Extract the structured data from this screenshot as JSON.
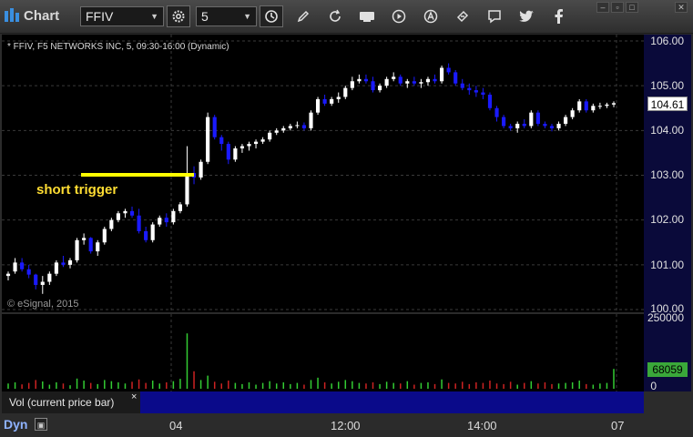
{
  "toolbar": {
    "title": "Chart",
    "symbol": "FFIV",
    "interval": "5",
    "icons": [
      "gear-icon",
      "clock-icon",
      "pencil-icon",
      "refresh-icon",
      "get-icon",
      "play-icon",
      "alert-icon",
      "link-icon",
      "chat-icon",
      "twitter-icon",
      "facebook-icon"
    ]
  },
  "header": {
    "info": "* FFIV, F5 NETWORKS INC, 5, 09:30-16:00 (Dynamic)",
    "watermark": "© eSignal, 2015"
  },
  "annotation": {
    "label": "short trigger",
    "price": 102.97,
    "color": "#ffff00"
  },
  "price_axis": {
    "labels": [
      "106.00",
      "105.00",
      "104.00",
      "103.00",
      "102.00",
      "101.00",
      "100.00"
    ],
    "last_price": "104.61"
  },
  "volume_axis": {
    "top": "250000",
    "zero": "0",
    "last_volume": "68059"
  },
  "time_axis": {
    "labels": [
      "04",
      "12:00",
      "14:00",
      "07"
    ]
  },
  "study": {
    "label": "Vol (current price bar)",
    "close": "×"
  },
  "footer": {
    "mode": "Dyn"
  },
  "colors": {
    "up_candle": "#ffffff",
    "down_candle": "#1a1aff",
    "volume_up": "#33cc33",
    "volume_down": "#cc2222",
    "background": "#000000"
  },
  "chart_data": {
    "type": "candlestick",
    "ylim": [
      100,
      106
    ],
    "ohlc": [
      [
        100.75,
        100.85,
        100.65,
        100.8
      ],
      [
        100.85,
        101.15,
        100.8,
        101.05
      ],
      [
        101.05,
        101.15,
        100.85,
        100.9
      ],
      [
        100.9,
        101.0,
        100.7,
        100.78
      ],
      [
        100.78,
        100.8,
        100.45,
        100.55
      ],
      [
        100.55,
        100.75,
        100.35,
        100.62
      ],
      [
        100.62,
        100.85,
        100.55,
        100.8
      ],
      [
        100.8,
        101.1,
        100.75,
        101.05
      ],
      [
        101.05,
        101.2,
        100.95,
        101.0
      ],
      [
        101.0,
        101.15,
        100.92,
        101.1
      ],
      [
        101.1,
        101.6,
        101.05,
        101.55
      ],
      [
        101.55,
        101.7,
        101.45,
        101.6
      ],
      [
        101.6,
        101.62,
        101.25,
        101.3
      ],
      [
        101.3,
        101.55,
        101.2,
        101.5
      ],
      [
        101.5,
        101.85,
        101.45,
        101.8
      ],
      [
        101.8,
        102.05,
        101.75,
        102.0
      ],
      [
        102.0,
        102.2,
        101.95,
        102.15
      ],
      [
        102.15,
        102.25,
        102.05,
        102.2
      ],
      [
        102.2,
        102.3,
        102.05,
        102.1
      ],
      [
        102.1,
        102.25,
        101.7,
        101.75
      ],
      [
        101.75,
        101.85,
        101.5,
        101.55
      ],
      [
        101.55,
        101.95,
        101.5,
        101.9
      ],
      [
        101.9,
        102.1,
        101.85,
        102.05
      ],
      [
        102.05,
        102.15,
        101.85,
        101.95
      ],
      [
        101.95,
        102.25,
        101.9,
        102.2
      ],
      [
        102.2,
        102.4,
        102.15,
        102.35
      ],
      [
        102.35,
        103.65,
        102.3,
        103.05
      ],
      [
        103.05,
        103.2,
        102.8,
        102.95
      ],
      [
        102.95,
        103.35,
        102.9,
        103.3
      ],
      [
        103.3,
        104.4,
        103.25,
        104.3
      ],
      [
        104.3,
        104.35,
        103.8,
        103.85
      ],
      [
        103.85,
        103.9,
        103.55,
        103.7
      ],
      [
        103.7,
        103.75,
        103.25,
        103.35
      ],
      [
        103.35,
        103.65,
        103.3,
        103.6
      ],
      [
        103.6,
        103.7,
        103.5,
        103.65
      ],
      [
        103.65,
        103.75,
        103.55,
        103.7
      ],
      [
        103.7,
        103.8,
        103.6,
        103.75
      ],
      [
        103.75,
        103.85,
        103.7,
        103.8
      ],
      [
        103.8,
        104.0,
        103.75,
        103.95
      ],
      [
        103.95,
        104.05,
        103.9,
        104.0
      ],
      [
        104.0,
        104.1,
        103.95,
        104.05
      ],
      [
        104.05,
        104.15,
        104.0,
        104.1
      ],
      [
        104.1,
        104.2,
        104.05,
        104.12
      ],
      [
        104.12,
        104.18,
        104.0,
        104.05
      ],
      [
        104.05,
        104.45,
        104.0,
        104.4
      ],
      [
        104.4,
        104.75,
        104.35,
        104.7
      ],
      [
        104.7,
        104.8,
        104.55,
        104.6
      ],
      [
        104.6,
        104.75,
        104.55,
        104.7
      ],
      [
        104.7,
        104.85,
        104.62,
        104.75
      ],
      [
        104.75,
        105.0,
        104.7,
        104.95
      ],
      [
        104.95,
        105.2,
        104.9,
        105.1
      ],
      [
        105.1,
        105.25,
        105.05,
        105.15
      ],
      [
        105.15,
        105.25,
        105.05,
        105.1
      ],
      [
        105.1,
        105.2,
        104.85,
        104.9
      ],
      [
        104.9,
        105.05,
        104.85,
        105.0
      ],
      [
        105.0,
        105.2,
        104.95,
        105.15
      ],
      [
        105.15,
        105.3,
        105.1,
        105.2
      ],
      [
        105.2,
        105.25,
        105.0,
        105.05
      ],
      [
        105.05,
        105.15,
        104.95,
        105.1
      ],
      [
        105.1,
        105.2,
        105.0,
        105.05
      ],
      [
        105.05,
        105.15,
        104.95,
        105.08
      ],
      [
        105.08,
        105.2,
        105.0,
        105.15
      ],
      [
        105.15,
        105.25,
        105.05,
        105.1
      ],
      [
        105.1,
        105.45,
        105.05,
        105.4
      ],
      [
        105.4,
        105.5,
        105.25,
        105.3
      ],
      [
        105.3,
        105.35,
        105.0,
        105.05
      ],
      [
        105.05,
        105.15,
        104.9,
        104.95
      ],
      [
        104.95,
        105.05,
        104.8,
        104.9
      ],
      [
        104.9,
        105.0,
        104.75,
        104.85
      ],
      [
        104.85,
        104.95,
        104.7,
        104.8
      ],
      [
        104.8,
        104.85,
        104.45,
        104.5
      ],
      [
        104.5,
        104.55,
        104.2,
        104.3
      ],
      [
        104.3,
        104.35,
        104.05,
        104.1
      ],
      [
        104.1,
        104.15,
        104.0,
        104.05
      ],
      [
        104.05,
        104.2,
        103.95,
        104.15
      ],
      [
        104.15,
        104.25,
        104.05,
        104.1
      ],
      [
        104.1,
        104.45,
        104.05,
        104.4
      ],
      [
        104.4,
        104.45,
        104.1,
        104.15
      ],
      [
        104.15,
        104.2,
        104.05,
        104.1
      ],
      [
        104.1,
        104.15,
        103.98,
        104.05
      ],
      [
        104.05,
        104.2,
        104.0,
        104.15
      ],
      [
        104.15,
        104.35,
        104.1,
        104.3
      ],
      [
        104.3,
        104.5,
        104.25,
        104.45
      ],
      [
        104.45,
        104.7,
        104.4,
        104.65
      ],
      [
        104.65,
        104.7,
        104.4,
        104.45
      ],
      [
        104.45,
        104.6,
        104.4,
        104.55
      ],
      [
        104.55,
        104.62,
        104.48,
        104.55
      ],
      [
        104.55,
        104.62,
        104.5,
        104.58
      ],
      [
        104.58,
        104.65,
        104.52,
        104.61
      ]
    ],
    "volume": [
      18000,
      22000,
      15000,
      20000,
      30000,
      25000,
      14000,
      22000,
      18000,
      12000,
      35000,
      28000,
      20000,
      16000,
      30000,
      26000,
      22000,
      18000,
      24000,
      32000,
      20000,
      28000,
      18000,
      22000,
      26000,
      34000,
      190000,
      60000,
      30000,
      45000,
      24000,
      18000,
      28000,
      20000,
      16000,
      22000,
      14000,
      20000,
      26000,
      18000,
      22000,
      16000,
      20000,
      14000,
      30000,
      38000,
      22000,
      18000,
      24000,
      30000,
      26000,
      20000,
      18000,
      22000,
      16000,
      24000,
      20000,
      18000,
      26000,
      14000,
      20000,
      22000,
      16000,
      32000,
      20000,
      18000,
      24000,
      16000,
      22000,
      20000,
      28000,
      18000,
      16000,
      24000,
      14000,
      20000,
      26000,
      18000,
      22000,
      16000,
      18000,
      20000,
      22000,
      28000,
      16000,
      14000,
      18000,
      20000,
      68059
    ],
    "volume_ylim": [
      0,
      250000
    ]
  }
}
